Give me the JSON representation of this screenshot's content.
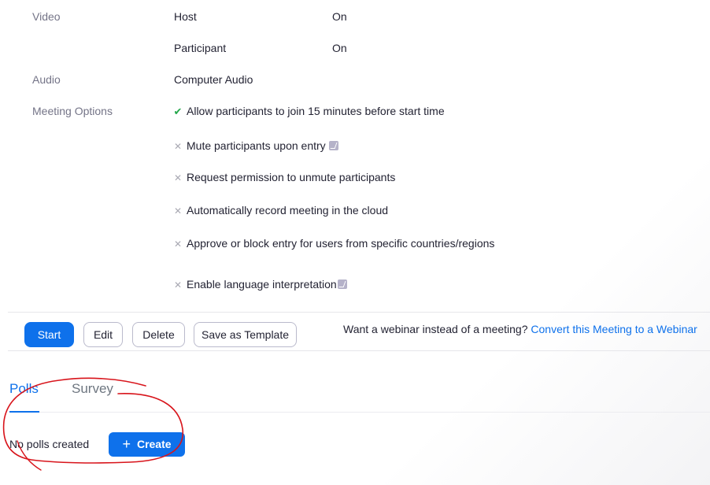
{
  "video": {
    "label": "Video",
    "host_label": "Host",
    "host_value": "On",
    "participant_label": "Participant",
    "participant_value": "On"
  },
  "audio": {
    "label": "Audio",
    "value": "Computer Audio"
  },
  "meeting_options": {
    "label": "Meeting Options",
    "items": [
      {
        "text": "Allow participants to join  15 minutes before start time",
        "enabled": true
      },
      {
        "text": "Mute participants upon entry",
        "enabled": false
      },
      {
        "text": "Request permission to unmute participants",
        "enabled": false
      },
      {
        "text": "Automatically record meeting in the cloud",
        "enabled": false
      },
      {
        "text": "Approve or block entry for users from specific countries/regions",
        "enabled": false
      },
      {
        "text": "Enable language interpretation",
        "enabled": false
      }
    ]
  },
  "actions": {
    "start": "Start",
    "edit": "Edit",
    "delete": "Delete",
    "save_template": "Save as Template",
    "webinar_prompt": "Want a webinar instead of a meeting?",
    "webinar_link": "Convert this Meeting to a Webinar"
  },
  "tabs": {
    "polls": "Polls",
    "survey": "Survey",
    "active": "polls"
  },
  "polls": {
    "empty_text": "No polls created",
    "create_label": "Create"
  },
  "colors": {
    "accent": "#0e71eb",
    "check": "#23a74a",
    "annotation": "#d8141b"
  },
  "icons": {
    "enabled": "check-icon",
    "disabled": "cross-icon",
    "badge": "pro-badge-icon",
    "create": "plus-icon"
  }
}
